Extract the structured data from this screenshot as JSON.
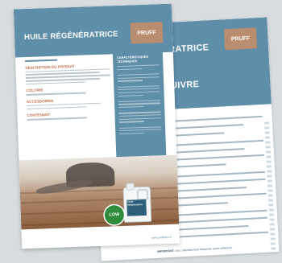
{
  "back_page": {
    "title": "TRATRICE",
    "heading": "SUIVRE",
    "logo": "PRUFF",
    "footer_label": "IMPORTANT",
    "footer_text": "Lisez attentivement l'étiquette avant utilisation."
  },
  "front_page": {
    "title": "HUILE RÉGÉNÉRATRICE",
    "logo": "PRUFF",
    "sections": [
      {
        "title": "DESCRIPTION DU PRODUIT"
      },
      {
        "title": "COLORIS"
      },
      {
        "title": "ACCESSOIRES"
      },
      {
        "title": "CONTENANT"
      }
    ],
    "panel_heading": "CARACTÉRISTIQUES TECHNIQUES",
    "bottle_label": "Huile Régénératrice",
    "badge": "LOW",
    "url": "www.pruffdeco.fr"
  },
  "colors": {
    "accent": "#5f8ea8",
    "section_title": "#c16e4a",
    "logo_bg": "#b98d6f",
    "badge": "#2f8c3c"
  }
}
